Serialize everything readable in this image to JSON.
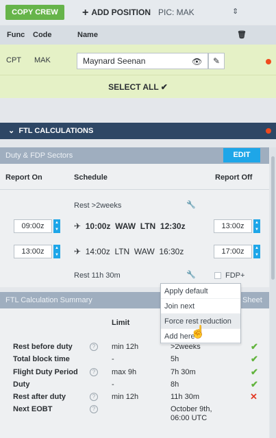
{
  "toolbar": {
    "copy_crew": "COPY CREW",
    "add_position": "ADD POSITION",
    "pic_label": "PIC: MAK"
  },
  "crew_table": {
    "headers": [
      "Func",
      "Code",
      "Name"
    ],
    "row": {
      "func": "CPT",
      "code": "MAK",
      "name": "Maynard Seenan"
    },
    "select_all": "SELECT ALL ✔"
  },
  "ftl": {
    "title": "FTL CALCULATIONS",
    "duty_title": "Duty & FDP Sectors",
    "edit": "EDIT",
    "columns": {
      "report_on": "Report On",
      "schedule": "Schedule",
      "report_off": "Report Off"
    },
    "rest_top": "Rest >2weeks",
    "sectors": [
      {
        "on": "09:00z",
        "off": "13:00z",
        "dep_time": "10:00z",
        "from": "WAW",
        "to": "LTN",
        "arr_time": "12:30z"
      },
      {
        "on": "13:00z",
        "off": "17:00z",
        "dep_time": "14:00z",
        "from": "LTN",
        "to": "WAW",
        "arr_time": "16:30z"
      }
    ],
    "rest_bottom": "Rest 11h 30m",
    "fdp_plus": "FDP+",
    "summary_title": "FTL Calculation Summary",
    "summary_sheet": "Sheet",
    "limit_header": "Limit",
    "summary_rows": [
      {
        "label": "Rest before duty",
        "limit": "min 12h",
        "value": ">2weeks",
        "status": "ok"
      },
      {
        "label": "Total block time",
        "limit": "-",
        "value": "5h",
        "status": "ok"
      },
      {
        "label": "Flight Duty Period",
        "limit": "max 9h",
        "value": "7h 30m",
        "status": "ok"
      },
      {
        "label": "Duty",
        "limit": "-",
        "value": "8h",
        "status": "ok"
      },
      {
        "label": "Rest after duty",
        "limit": "min 12h",
        "value": "11h 30m",
        "status": "bad"
      },
      {
        "label": "Next EOBT",
        "limit": "",
        "value": "October 9th,",
        "value2": "06:00 UTC",
        "status": ""
      }
    ]
  },
  "context_menu": [
    "Apply default",
    "Join next",
    "Force rest reduction",
    "Add here"
  ],
  "colors": {
    "green": "#66b44a",
    "navy": "#2e4765",
    "blue": "#1ea6e8",
    "red": "#f04a1e"
  }
}
